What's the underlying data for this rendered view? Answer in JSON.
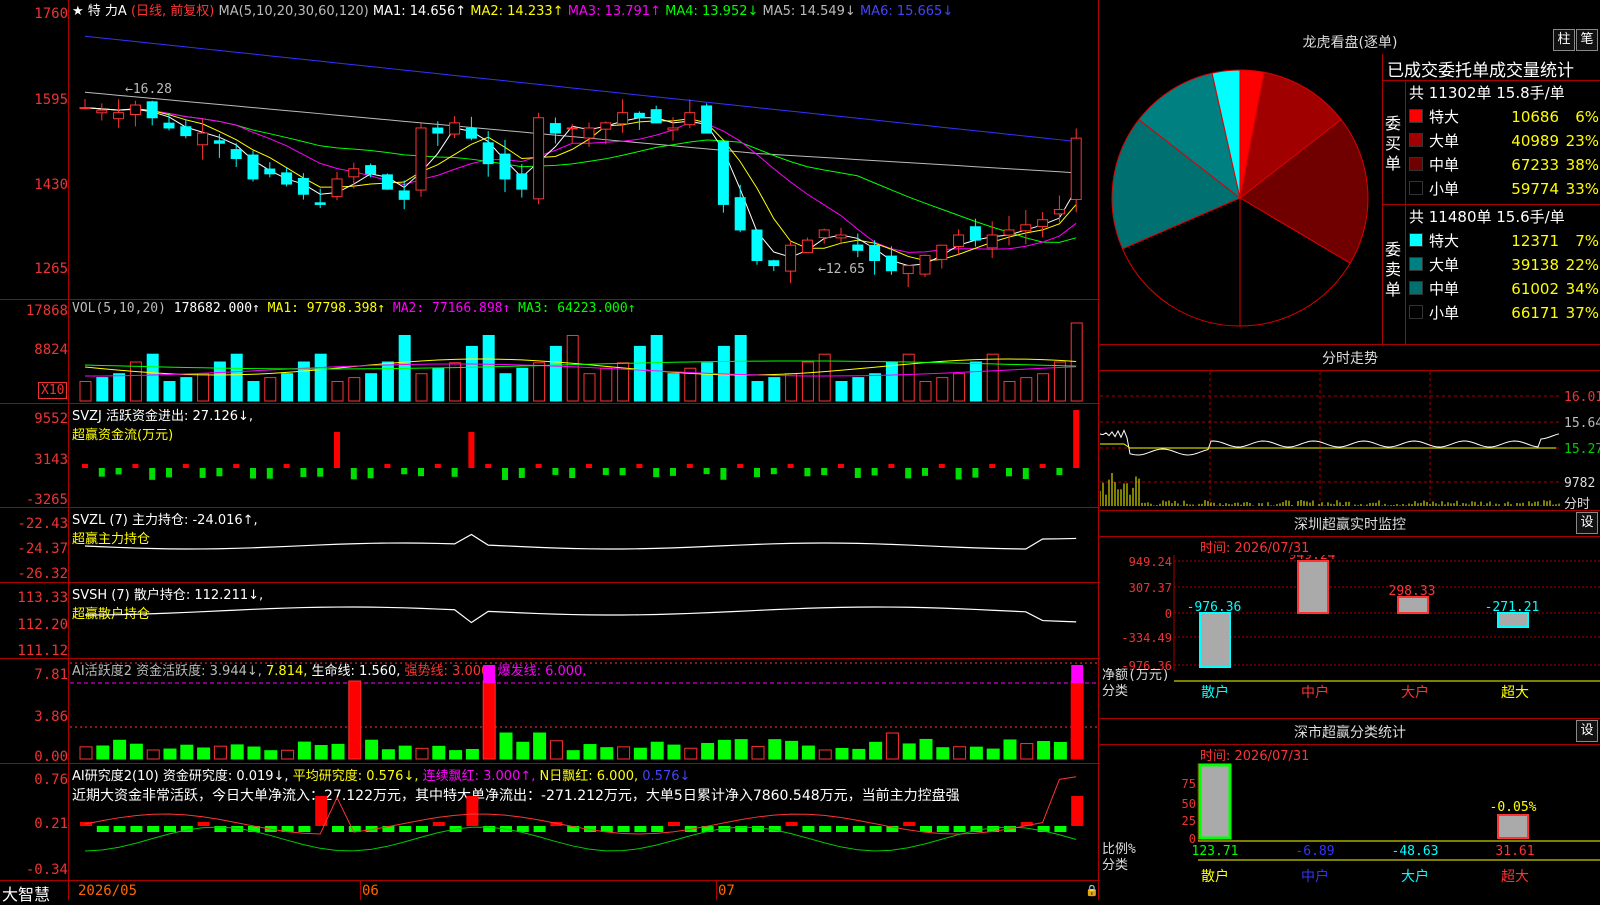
{
  "header": {
    "star": "★",
    "stock_name": "特 力A",
    "chart_mode": "(日线, 前复权)",
    "ma_params": "MA(5,10,20,30,60,120)",
    "ma1": "MA1: 14.656↑",
    "ma2": "MA2: 14.233↑",
    "ma3": "MA3: 13.791↑",
    "ma4": "MA4: 13.952↓",
    "ma5": "MA5: 14.549↓",
    "ma6": "MA6: 15.665↓"
  },
  "price_axis": [
    "1760",
    "1595",
    "1430",
    "1265"
  ],
  "price_annotations": {
    "high": "←16.28",
    "low": "←12.65"
  },
  "vol_panel": {
    "title": "VOL(5,10,20)",
    "value": "178682.000↑",
    "ma1": "MA1: 97798.398↑",
    "ma2": "MA2: 77166.898↑",
    "ma3": "MA3: 64223.000↑",
    "axis": [
      "17868",
      "8824"
    ],
    "unit": "X10"
  },
  "svzj_panel": {
    "title": "SVZJ  活跃资金进出: 27.126↓,",
    "subtitle": "超赢资金流(万元)",
    "axis": [
      "9552",
      "3143",
      "-3265"
    ]
  },
  "svzl_panel": {
    "title": "SVZL (7) 主力持仓: -24.016↑,",
    "subtitle": "超赢主力持仓",
    "axis": [
      "-22.43",
      "-24.37",
      "-26.32"
    ]
  },
  "svsh_panel": {
    "title": "SVSH (7) 散户持仓: 112.211↓,",
    "subtitle": "超赢散户持仓",
    "axis": [
      "113.33",
      "112.20",
      "111.12"
    ]
  },
  "ai_active_panel": {
    "title": "AI活跃度2 资金活跃度: 3.944↓,",
    "v2": "7.814,",
    "v3": "生命线: 1.560,",
    "v4": "强势线: 3.000,",
    "v5": "爆发线: 6.000,",
    "axis": [
      "7.81",
      "3.86",
      "0.00"
    ]
  },
  "ai_research_panel": {
    "title": "AI研究度2(10) 资金研究度: 0.019↓,",
    "v2": "平均研究度: 0.576↓,",
    "v3": "连续飘红: 3.000↑,",
    "v4": "N日飘红: 6.000,",
    "v5": "0.576↓",
    "comment": "近期大资金非常活跃，今日大单净流入：27.122万元，其中特大单净流出：-271.212万元，大单5日累计净入7860.548万元，当前主力控盘强",
    "axis": [
      "0.76",
      "0.21",
      "-0.34"
    ]
  },
  "date_axis": {
    "d1": "2026/05",
    "d2": "06",
    "d3": "07"
  },
  "brand": "大智慧",
  "dragon_tiger": {
    "title": "龙虎看盘(逐单)",
    "btn1": "柱",
    "btn2": "笔",
    "table_title": "已成交委托单成交量统计",
    "buy_label": "委买单",
    "sell_label": "委卖单",
    "buy_header": "共 11302单 15.8手/单",
    "sell_header": "共 11480单 15.6手/单",
    "buy_rows": [
      {
        "name": "特大",
        "count": "10686",
        "pct": "6%",
        "color": "#ff0000"
      },
      {
        "name": "大单",
        "count": "40989",
        "pct": "23%",
        "color": "#a00000"
      },
      {
        "name": "中单",
        "count": "67233",
        "pct": "38%",
        "color": "#700000"
      },
      {
        "name": "小单",
        "count": "59774",
        "pct": "33%",
        "color": "#000000"
      }
    ],
    "sell_rows": [
      {
        "name": "特大",
        "count": "12371",
        "pct": "7%",
        "color": "#00ffff"
      },
      {
        "name": "大单",
        "count": "39138",
        "pct": "22%",
        "color": "#008080"
      },
      {
        "name": "中单",
        "count": "61002",
        "pct": "34%",
        "color": "#007070"
      },
      {
        "name": "小单",
        "count": "66171",
        "pct": "37%",
        "color": "#000000"
      }
    ]
  },
  "intraday": {
    "title": "分时走势",
    "axis": [
      "16.01",
      "15.64",
      "15.27",
      "9782",
      "分时"
    ]
  },
  "sz_monitor": {
    "title": "深圳超赢实时监控",
    "btn": "设",
    "time_label": "时间: 2026/07/31",
    "axis": [
      "949.24",
      "307.37",
      "0",
      "-334.49",
      "-976.36"
    ],
    "bar_labels": [
      "-976.36",
      "949.24",
      "298.33",
      "-271.21"
    ],
    "categories": [
      "散户",
      "中户",
      "大户",
      "超大"
    ],
    "unit_label": "净额(万元)",
    "class_label": "分类"
  },
  "sz_stats": {
    "title": "深市超赢分类统计",
    "btn": "设",
    "time_label": "时间: 2026/07/31",
    "axis": [
      "75",
      "50",
      "25",
      "0"
    ],
    "bar_labels": [
      "123.71",
      "-6.89",
      "-48.63",
      "31.61"
    ],
    "extra_label": "-0.05%",
    "categories": [
      "散户",
      "中户",
      "大户",
      "超大"
    ],
    "unit_label": "比例%",
    "class_label": "分类"
  }
}
